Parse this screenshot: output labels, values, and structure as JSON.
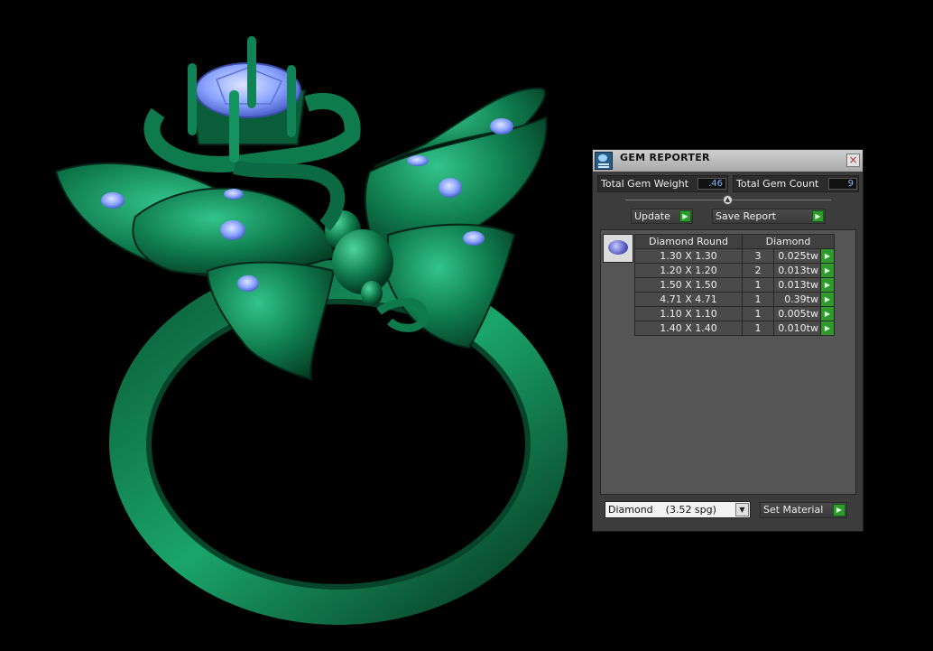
{
  "panel": {
    "title": "GEM REPORTER",
    "close_icon": "×",
    "total_weight_label": "Total Gem Weight",
    "total_weight_value": ".46",
    "total_count_label": "Total Gem Count",
    "total_count_value": "9",
    "update_label": "Update",
    "save_report_label": "Save Report",
    "go_glyph": "▶",
    "splitter_glyph": "▲"
  },
  "table": {
    "headers": [
      "Diamond Round",
      "Diamond"
    ],
    "rows": [
      {
        "size": "1.30 X 1.30",
        "count": "3",
        "weight": "0.025tw"
      },
      {
        "size": "1.20 X 1.20",
        "count": "2",
        "weight": "0.013tw"
      },
      {
        "size": "1.50 X 1.50",
        "count": "1",
        "weight": "0.013tw"
      },
      {
        "size": "4.71 X 4.71",
        "count": "1",
        "weight": "0.39tw"
      },
      {
        "size": "1.10 X 1.10",
        "count": "1",
        "weight": "0.005tw"
      },
      {
        "size": "1.40 X 1.40",
        "count": "1",
        "weight": "0.010tw"
      }
    ]
  },
  "material": {
    "selected": "Diamond    (3.52 spg)",
    "dropdown_glyph": "▼",
    "set_label": "Set Material"
  },
  "colors": {
    "ring_green": "#0f7a4c",
    "gem_blue": "#8aa4ff",
    "button_green": "#2e9a2e"
  }
}
